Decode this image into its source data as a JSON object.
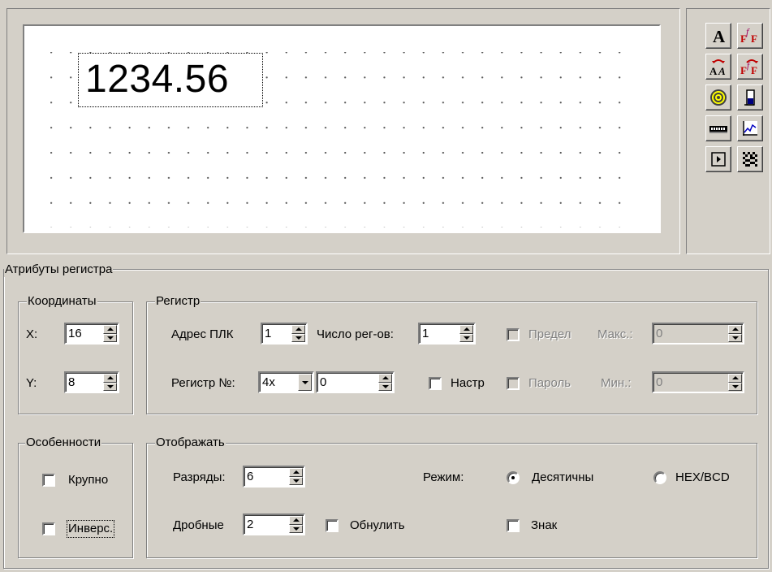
{
  "preview": {
    "sample_value": "1234.56"
  },
  "toolbox": {
    "tools": [
      {
        "name": "text-tool",
        "icon": "text-a-icon"
      },
      {
        "name": "font-style-tool",
        "icon": "font-f-icon"
      },
      {
        "name": "swap-text-tool",
        "icon": "swap-aa-icon"
      },
      {
        "name": "swap-font-tool",
        "icon": "swap-font-icon"
      },
      {
        "name": "lamp-tool",
        "icon": "lamp-icon"
      },
      {
        "name": "bar-tool",
        "icon": "bar-gauge-icon"
      },
      {
        "name": "numeric-display-tool",
        "icon": "numeric-display-icon"
      },
      {
        "name": "trend-tool",
        "icon": "trend-chart-icon"
      },
      {
        "name": "button-tool",
        "icon": "play-button-icon"
      },
      {
        "name": "bitmap-tool",
        "icon": "bitmap-pattern-icon"
      }
    ]
  },
  "register_attributes": {
    "title": "Атрибуты регистра",
    "coordinates": {
      "title": "Координаты",
      "x_label": "X:",
      "x_value": "16",
      "y_label": "Y:",
      "y_value": "8"
    },
    "register": {
      "title": "Регистр",
      "plc_address_label": "Адрес ПЛК",
      "plc_address_value": "1",
      "reg_count_label": "Число рег-ов:",
      "reg_count_value": "1",
      "register_no_label": "Регистр №:",
      "register_type_value": "4x",
      "register_no_value": "0",
      "setup_label": "Настр",
      "limit_label": "Предел",
      "password_label": "Пароль",
      "max_label": "Макс.:",
      "max_value": "0",
      "min_label": "Мин.:",
      "min_value": "0"
    },
    "features": {
      "title": "Особенности",
      "large_label": "Крупно",
      "inverse_label": "Инверс."
    },
    "display": {
      "title": "Отображать",
      "digits_label": "Разряды:",
      "digits_value": "6",
      "fraction_label": "Дробные",
      "fraction_value": "2",
      "zero_fill_label": "Обнулить",
      "mode_label": "Режим:",
      "decimal_label": "Десятичны",
      "hex_label": "HEX/BCD",
      "sign_label": "Знак",
      "selected_mode": "decimal"
    }
  }
}
